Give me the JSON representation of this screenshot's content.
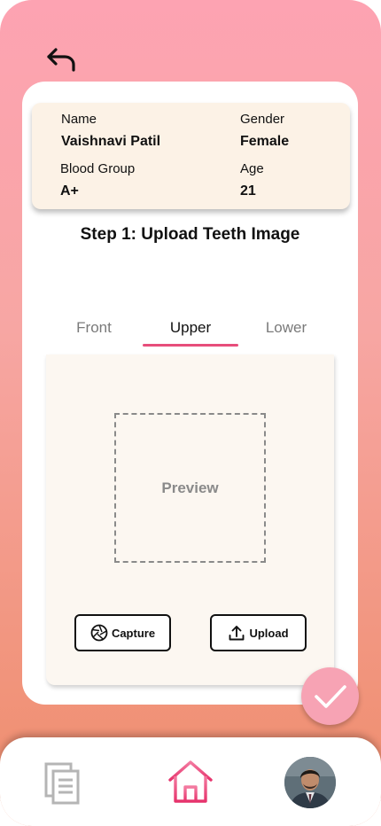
{
  "header": {
    "back_icon": "undo-arrow-icon"
  },
  "patient": {
    "name_label": "Name",
    "name_value": "Vaishnavi Patil",
    "gender_label": "Gender",
    "gender_value": "Female",
    "blood_group_label": "Blood Group",
    "blood_group_value": "A+",
    "age_label": "Age",
    "age_value": "21"
  },
  "step": {
    "title": "Step 1: Upload Teeth Image"
  },
  "tabs": [
    {
      "label": "Front",
      "active": false
    },
    {
      "label": "Upper",
      "active": true
    },
    {
      "label": "Lower",
      "active": false
    }
  ],
  "upload": {
    "preview_label": "Preview",
    "capture_label": "Capture",
    "capture_icon": "camera-shutter-icon",
    "upload_label": "Upload",
    "upload_icon": "upload-icon"
  },
  "fab": {
    "icon": "checkmark-icon"
  },
  "bottom_nav": {
    "items": [
      {
        "icon": "documents-icon"
      },
      {
        "icon": "home-icon",
        "active": true
      },
      {
        "icon": "profile-avatar"
      }
    ]
  },
  "colors": {
    "accent": "#e74d7b",
    "card_bg": "#fcf2e6",
    "panel_bg": "#fcf7f1",
    "fab_bg": "#f7a3b4",
    "gradient_top": "#fda3b2",
    "gradient_bottom": "#ef8d6c"
  }
}
